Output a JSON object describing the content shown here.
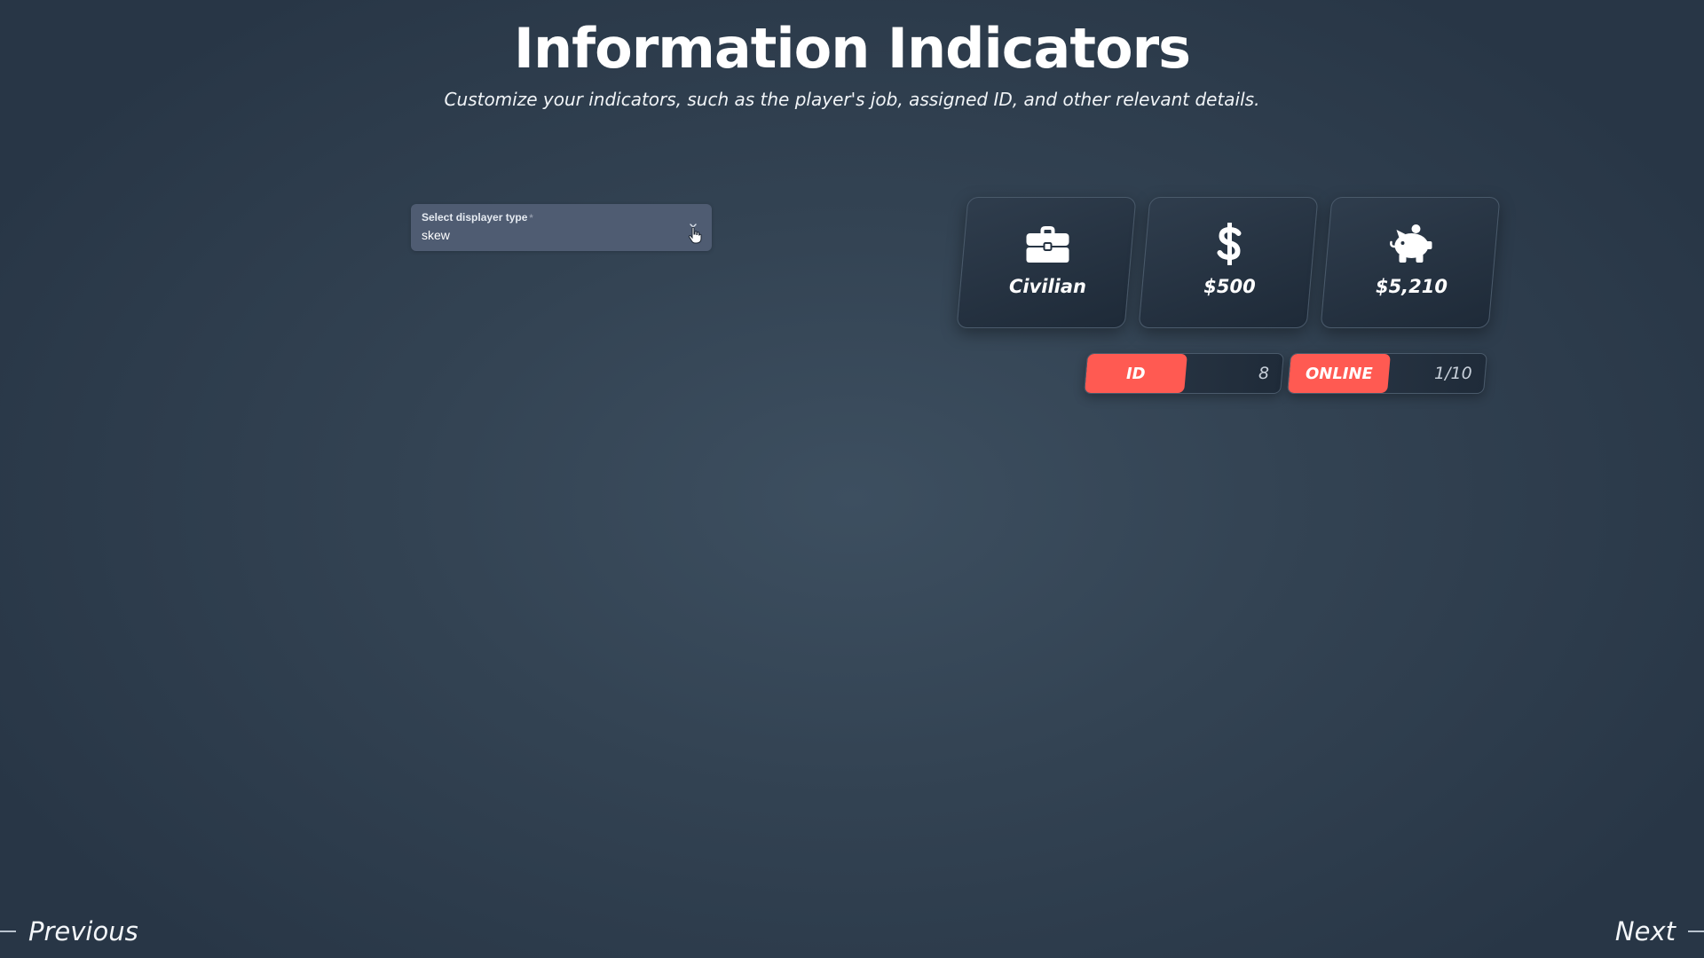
{
  "header": {
    "title": "Information Indicators",
    "subtitle": "Customize your indicators, such as the player's job, assigned ID, and other relevant details."
  },
  "displayer_select": {
    "label": "Select displayer type",
    "required_mark": "*",
    "value": "skew",
    "icon": "chevron-down-icon"
  },
  "cards": [
    {
      "icon": "briefcase-icon",
      "value": "Civilian"
    },
    {
      "icon": "dollar-icon",
      "value": "$500"
    },
    {
      "icon": "piggy-bank-icon",
      "value": "$5,210"
    }
  ],
  "pills": [
    {
      "label": "ID",
      "value": "8"
    },
    {
      "label": "ONLINE",
      "value": "1/10"
    }
  ],
  "navigation": {
    "previous_label": "Previous",
    "next_label": "Next"
  },
  "colors": {
    "accent": "#ff5a52",
    "background": "#334353",
    "card": "#1e2a38",
    "select": "#4f5c72"
  }
}
